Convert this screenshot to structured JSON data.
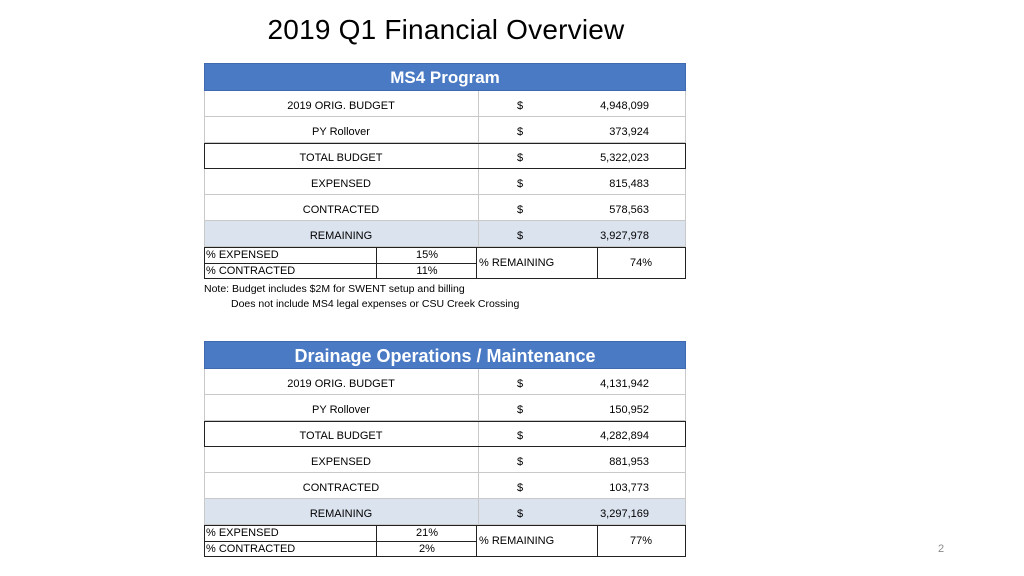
{
  "slide": {
    "title": "2019 Q1 Financial Overview",
    "page_number": "2"
  },
  "ms4": {
    "header": "MS4 Program",
    "rows": [
      {
        "label": "2019 ORIG. BUDGET",
        "currency": "$",
        "value": "4,948,099"
      },
      {
        "label": "PY Rollover",
        "currency": "$",
        "value": "373,924"
      },
      {
        "label": "TOTAL BUDGET",
        "currency": "$",
        "value": "5,322,023"
      },
      {
        "label": "EXPENSED",
        "currency": "$",
        "value": "815,483"
      },
      {
        "label": "CONTRACTED",
        "currency": "$",
        "value": "578,563"
      },
      {
        "label": "REMAINING",
        "currency": "$",
        "value": "3,927,978"
      }
    ],
    "pct": {
      "expensed_label": "% EXPENSED",
      "expensed_value": "15%",
      "contracted_label": "% CONTRACTED",
      "contracted_value": "11%",
      "remaining_label": "% REMAINING",
      "remaining_value": "74%"
    },
    "notes": [
      "Note:  Budget includes $2M for SWENT setup and billing",
      "Does not include MS4 legal expenses or CSU Creek Crossing"
    ]
  },
  "drainage": {
    "header": "Drainage Operations / Maintenance",
    "rows": [
      {
        "label": "2019 ORIG. BUDGET",
        "currency": "$",
        "value": "4,131,942"
      },
      {
        "label": "PY Rollover",
        "currency": "$",
        "value": "150,952"
      },
      {
        "label": "TOTAL BUDGET",
        "currency": "$",
        "value": "4,282,894"
      },
      {
        "label": "EXPENSED",
        "currency": "$",
        "value": "881,953"
      },
      {
        "label": "CONTRACTED",
        "currency": "$",
        "value": "103,773"
      },
      {
        "label": "REMAINING",
        "currency": "$",
        "value": "3,297,169"
      }
    ],
    "pct": {
      "expensed_label": "% EXPENSED",
      "expensed_value": "21%",
      "contracted_label": "% CONTRACTED",
      "contracted_value": "2%",
      "remaining_label": "% REMAINING",
      "remaining_value": "77%"
    }
  },
  "colors": {
    "header_bg": "#4a7ac4",
    "remaining_bg": "#dbe3ef",
    "header_text": "#ffffff"
  }
}
